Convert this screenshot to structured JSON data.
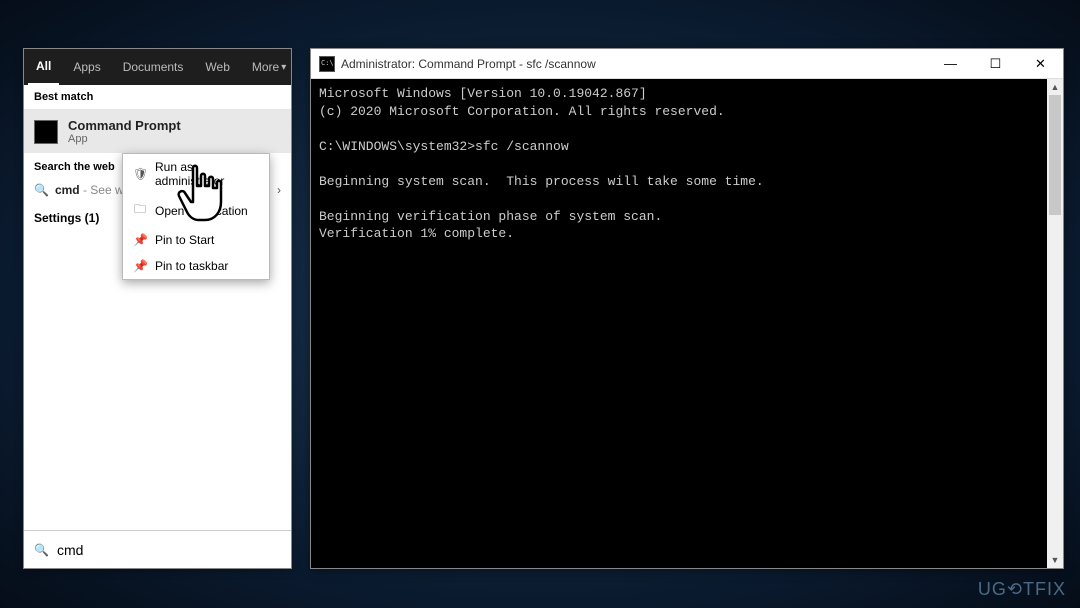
{
  "tabs": {
    "all": "All",
    "apps": "Apps",
    "documents": "Documents",
    "web": "Web",
    "more": "More"
  },
  "best_match_header": "Best match",
  "result": {
    "title": "Command Prompt",
    "subtitle": "App"
  },
  "search_web": {
    "header": "Search the web",
    "term": "cmd",
    "hint": " - See web",
    "chevron": "›"
  },
  "settings_row": "Settings (1)",
  "search_input": {
    "value": "cmd"
  },
  "context_menu": {
    "run_admin": "Run as administrator",
    "open_location": "Open file location",
    "pin_start": "Pin to Start",
    "pin_taskbar": "Pin to taskbar"
  },
  "cmd_window": {
    "title": "Administrator: Command Prompt - sfc  /scannow",
    "lines": {
      "l1": "Microsoft Windows [Version 10.0.19042.867]",
      "l2": "(c) 2020 Microsoft Corporation. All rights reserved.",
      "l3": "",
      "l4": "C:\\WINDOWS\\system32>sfc /scannow",
      "l5": "",
      "l6": "Beginning system scan.  This process will take some time.",
      "l7": "",
      "l8": "Beginning verification phase of system scan.",
      "l9": "Verification 1% complete."
    }
  },
  "watermark": "UG⟲TFIX"
}
